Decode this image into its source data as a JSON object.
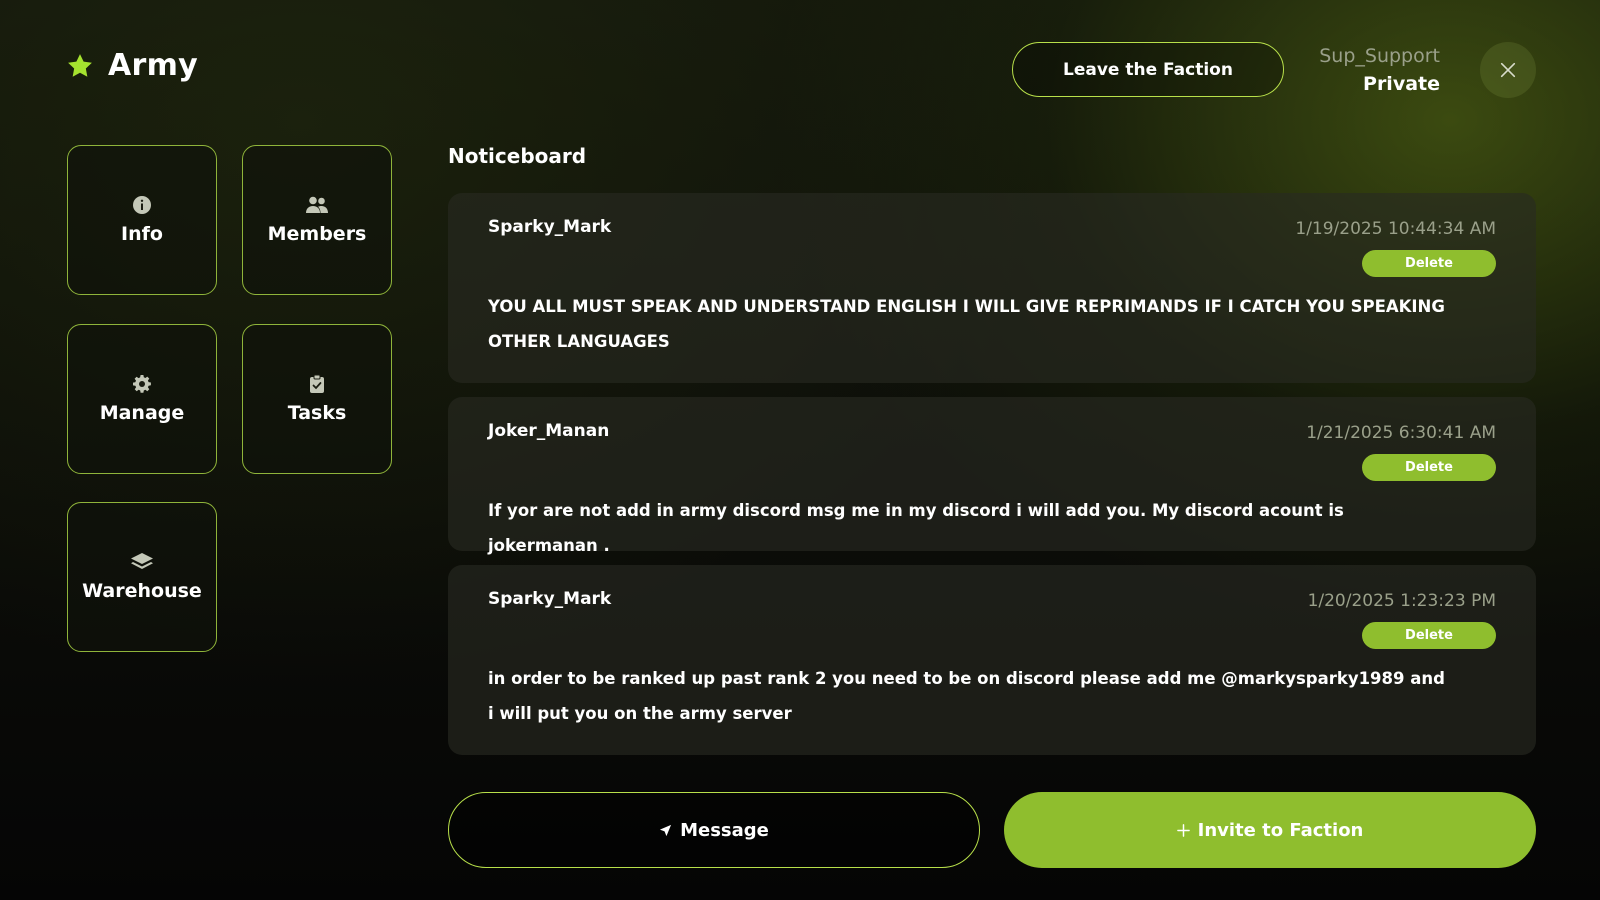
{
  "header": {
    "title": "Army",
    "star_color": "#a5e22f",
    "leave_label": "Leave the Faction",
    "user_name": "Sup_Support",
    "user_rank": "Private"
  },
  "sidebar": {
    "items": [
      {
        "label": "Info",
        "icon": "info-icon"
      },
      {
        "label": "Members",
        "icon": "members-icon"
      },
      {
        "label": "Manage",
        "icon": "gear-icon"
      },
      {
        "label": "Tasks",
        "icon": "clipboard-icon"
      },
      {
        "label": "Warehouse",
        "icon": "layers-icon"
      }
    ]
  },
  "noticeboard": {
    "title": "Noticeboard",
    "delete_label": "Delete",
    "notices": [
      {
        "author": "Sparky_Mark",
        "time": "1/19/2025 10:44:34 AM",
        "message": "YOU ALL MUST SPEAK AND UNDERSTAND ENGLISH I WILL GIVE REPRIMANDS IF I CATCH YOU SPEAKING OTHER LANGUAGES"
      },
      {
        "author": "Joker_Manan",
        "time": "1/21/2025 6:30:41 AM",
        "message": "If yor are not add in army discord msg me in my discord i will add you. My discord acount is jokermanan ."
      },
      {
        "author": "Sparky_Mark",
        "time": "1/20/2025 1:23:23 PM",
        "message": "in order to be ranked up past rank 2 you need to be on discord please add me @markysparky1989 and i will put you on the army server"
      }
    ]
  },
  "actions": {
    "message_label": "Message",
    "invite_label": "Invite to Faction",
    "accent_color": "#8fbe2e"
  }
}
